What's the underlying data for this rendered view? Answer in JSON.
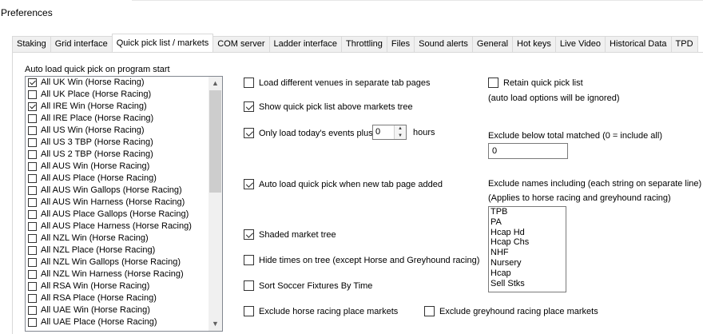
{
  "window": {
    "title": "Preferences"
  },
  "tabs": [
    {
      "label": "Staking"
    },
    {
      "label": "Grid interface"
    },
    {
      "label": "Quick pick list / markets"
    },
    {
      "label": "COM server"
    },
    {
      "label": "Ladder interface"
    },
    {
      "label": "Throttling"
    },
    {
      "label": "Files"
    },
    {
      "label": "Sound alerts"
    },
    {
      "label": "General"
    },
    {
      "label": "Hot keys"
    },
    {
      "label": "Live Video"
    },
    {
      "label": "Historical Data"
    },
    {
      "label": "TPD"
    }
  ],
  "active_tab": "Quick pick list / markets",
  "autoload": {
    "label": "Auto load quick pick on program start",
    "items": [
      {
        "label": "All UK Win (Horse Racing)",
        "checked": true
      },
      {
        "label": "All UK Place (Horse Racing)",
        "checked": false
      },
      {
        "label": "All IRE Win (Horse Racing)",
        "checked": true
      },
      {
        "label": "All IRE Place (Horse Racing)",
        "checked": false
      },
      {
        "label": "All US Win (Horse Racing)",
        "checked": false
      },
      {
        "label": "All US 3 TBP (Horse Racing)",
        "checked": false
      },
      {
        "label": "All US 2 TBP (Horse Racing)",
        "checked": false
      },
      {
        "label": "All AUS Win (Horse Racing)",
        "checked": false
      },
      {
        "label": "All AUS Place (Horse Racing)",
        "checked": false
      },
      {
        "label": "All AUS Win Gallops (Horse Racing)",
        "checked": false
      },
      {
        "label": "All AUS Win Harness (Horse Racing)",
        "checked": false
      },
      {
        "label": "All AUS Place Gallops (Horse Racing)",
        "checked": false
      },
      {
        "label": "All AUS Place Harness (Horse Racing)",
        "checked": false
      },
      {
        "label": "All NZL Win (Horse Racing)",
        "checked": false
      },
      {
        "label": "All NZL Place (Horse Racing)",
        "checked": false
      },
      {
        "label": "All NZL Win Gallops (Horse Racing)",
        "checked": false
      },
      {
        "label": "All NZL Win Harness (Horse Racing)",
        "checked": false
      },
      {
        "label": "All RSA Win (Horse Racing)",
        "checked": false
      },
      {
        "label": "All RSA Place (Horse Racing)",
        "checked": false
      },
      {
        "label": "All UAE Win (Horse Racing)",
        "checked": false
      },
      {
        "label": "All UAE Place (Horse Racing)",
        "checked": false
      }
    ]
  },
  "options": {
    "separate_tabs": {
      "label": "Load different venues in separate tab pages",
      "checked": false
    },
    "show_above_tree": {
      "label": "Show quick pick list above markets tree",
      "checked": true
    },
    "only_today": {
      "label": "Only load today's events plus",
      "checked": true,
      "hours_value": "0",
      "hours_label": "hours"
    },
    "auto_load_new_tab": {
      "label": "Auto load quick pick when new tab page added",
      "checked": true
    },
    "shaded_tree": {
      "label": "Shaded market tree",
      "checked": true
    },
    "hide_times": {
      "label": "Hide times on tree (except Horse and Greyhound racing)",
      "checked": false
    },
    "sort_soccer": {
      "label": "Sort Soccer Fixtures By Time",
      "checked": false
    },
    "exclude_horse_place": {
      "label": "Exclude horse racing place markets",
      "checked": false
    },
    "exclude_grey_place": {
      "label": "Exclude greyhound racing place markets",
      "checked": false
    },
    "retain": {
      "label": "Retain quick pick list",
      "checked": false,
      "note": "(auto load options will be ignored)"
    }
  },
  "exclude_total": {
    "label": "Exclude below total matched (0 = include all)",
    "value": "0"
  },
  "exclude_names": {
    "label": "Exclude names including (each string on separate line)",
    "note": "(Applies to horse racing and greyhound racing)",
    "lines": [
      "TPB",
      "PA",
      "Hcap Hd",
      "Hcap Chs",
      "NHF",
      "Nursery",
      "Hcap",
      "Sell Stks"
    ]
  },
  "icons": {
    "scroll_up": "chevron-up-icon",
    "scroll_down": "chevron-down-icon"
  }
}
